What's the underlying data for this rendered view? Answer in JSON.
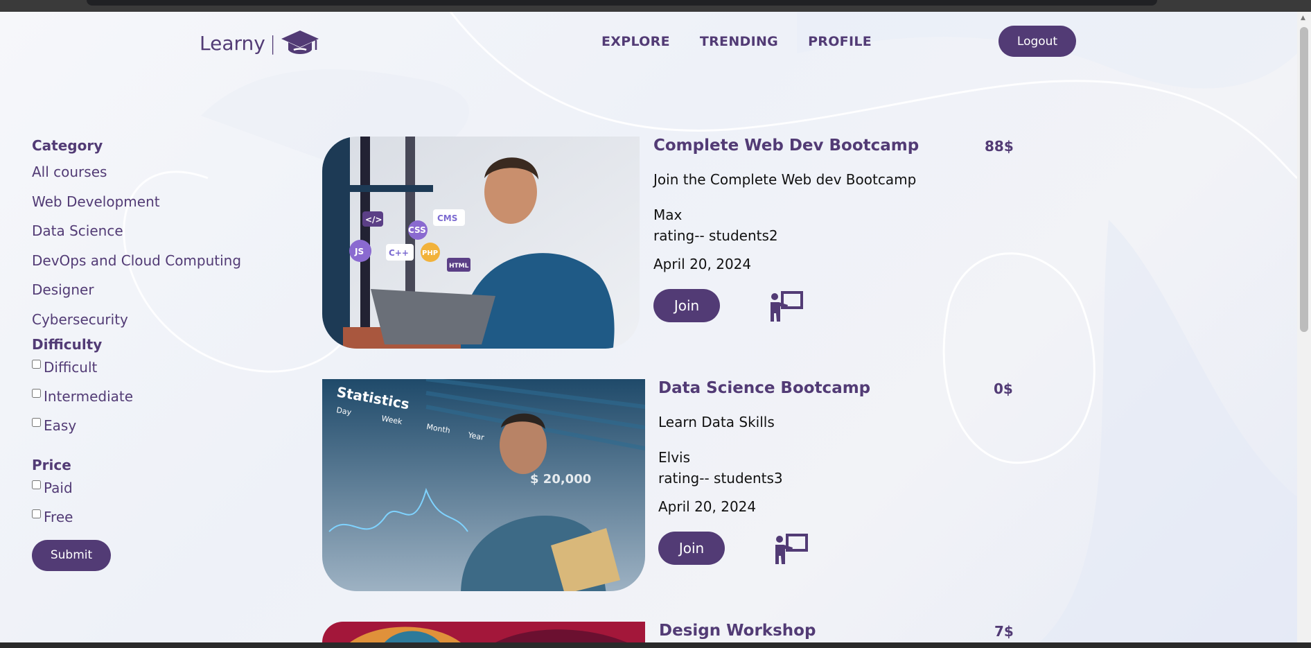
{
  "header": {
    "logo_text": "Learny",
    "logo_sep": "|",
    "nav": [
      "EXPLORE",
      "TRENDING",
      "PROFILE"
    ],
    "logout_label": "Logout"
  },
  "sidebar": {
    "category_title": "Category",
    "categories": [
      "All courses",
      "Web Development",
      "Data Science",
      "DevOps and Cloud Computing",
      "Designer",
      "Cybersecurity"
    ],
    "difficulty_title": "Difficulty",
    "difficulties": [
      "Difficult",
      "Intermediate",
      "Easy"
    ],
    "price_title": "Price",
    "prices": [
      "Paid",
      "Free"
    ],
    "submit_label": "Submit"
  },
  "courses": [
    {
      "title": "Complete Web Dev Bootcamp",
      "description": "Join the Complete Web dev Bootcamp",
      "author": "Max",
      "meta": "rating-- students2",
      "date": "April 20, 2024",
      "price": "88$",
      "join_label": "Join",
      "thumb_tags": [
        "</>",
        "CSS",
        "CMS",
        "JS",
        "C++",
        "PHP",
        "HTML"
      ]
    },
    {
      "title": "Data Science Bootcamp",
      "description": "Learn Data Skills",
      "author": "Elvis",
      "meta": "rating-- students3",
      "date": "April 20, 2024",
      "price": "0$",
      "join_label": "Join",
      "thumb_tags": [
        "Statistics",
        "Day",
        "Week",
        "Month",
        "Year",
        "$ 20,000"
      ]
    },
    {
      "title": "Design Workshop",
      "price": "7$"
    }
  ],
  "colors": {
    "brand": "#523b75",
    "background": "#f3f4f7"
  }
}
